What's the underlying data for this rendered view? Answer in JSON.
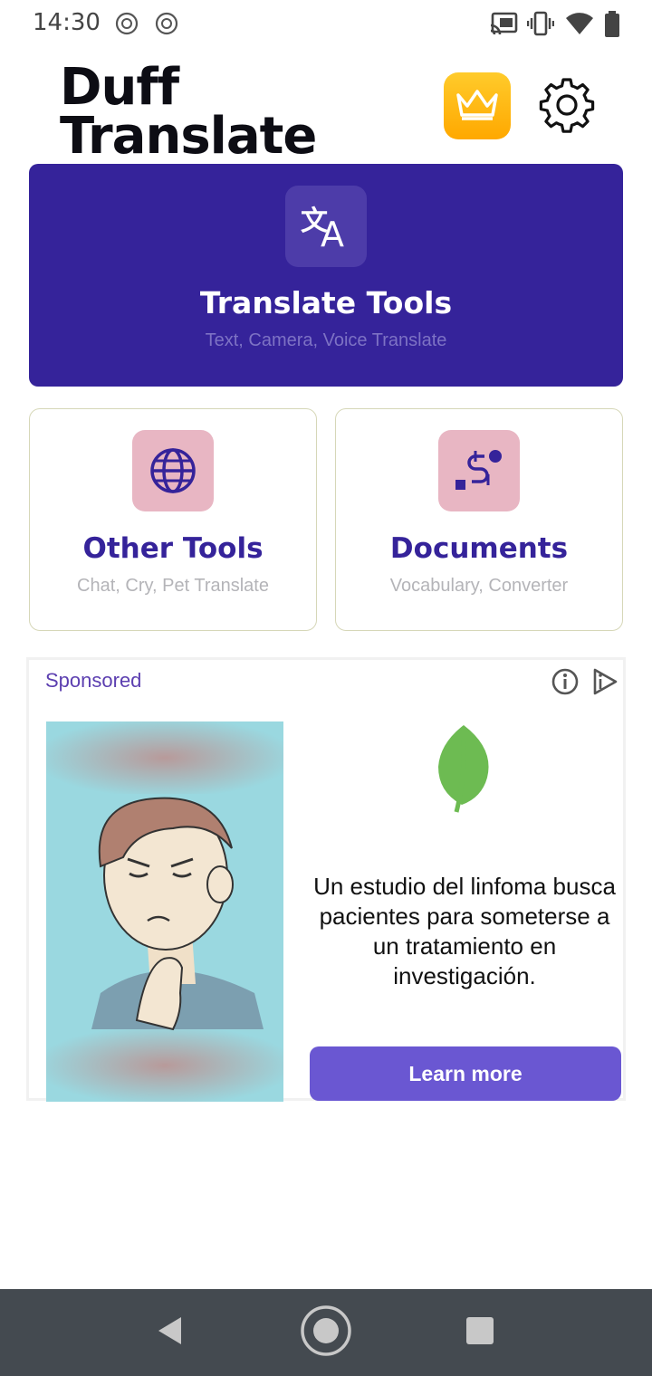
{
  "status_bar": {
    "time": "14:30",
    "icons_left": [
      "notification-icon",
      "notification-icon"
    ],
    "icons_right": [
      "cast-icon",
      "vibrate-icon",
      "wifi-icon",
      "battery-icon"
    ]
  },
  "header": {
    "title_line1": "Duff",
    "title_line2": "Translate",
    "premium_icon": "crown-icon",
    "settings_icon": "gear-icon"
  },
  "translate_card": {
    "icon": "translate-icon",
    "title": "Translate Tools",
    "subtitle": "Text, Camera, Voice Translate"
  },
  "tool_cards": [
    {
      "icon": "globe-icon",
      "title": "Other Tools",
      "subtitle": "Chat, Cry, Pet Translate"
    },
    {
      "icon": "route-icon",
      "title": "Documents",
      "subtitle": "Vocabulary, Converter"
    }
  ],
  "ad": {
    "label": "Sponsored",
    "text": "Un estudio del linfoma busca pacientes para someterse a un tratamiento en investigación.",
    "cta": "Learn more"
  },
  "nav_bar": {
    "back_icon": "back-icon",
    "home_icon": "home-icon",
    "recents_icon": "recents-icon"
  },
  "colors": {
    "primary": "#35239a",
    "accent_pink": "#e8b6c3",
    "premium_yellow": "#ffb800",
    "ad_button": "#6a57d2",
    "nav_bar": "#444a50"
  }
}
